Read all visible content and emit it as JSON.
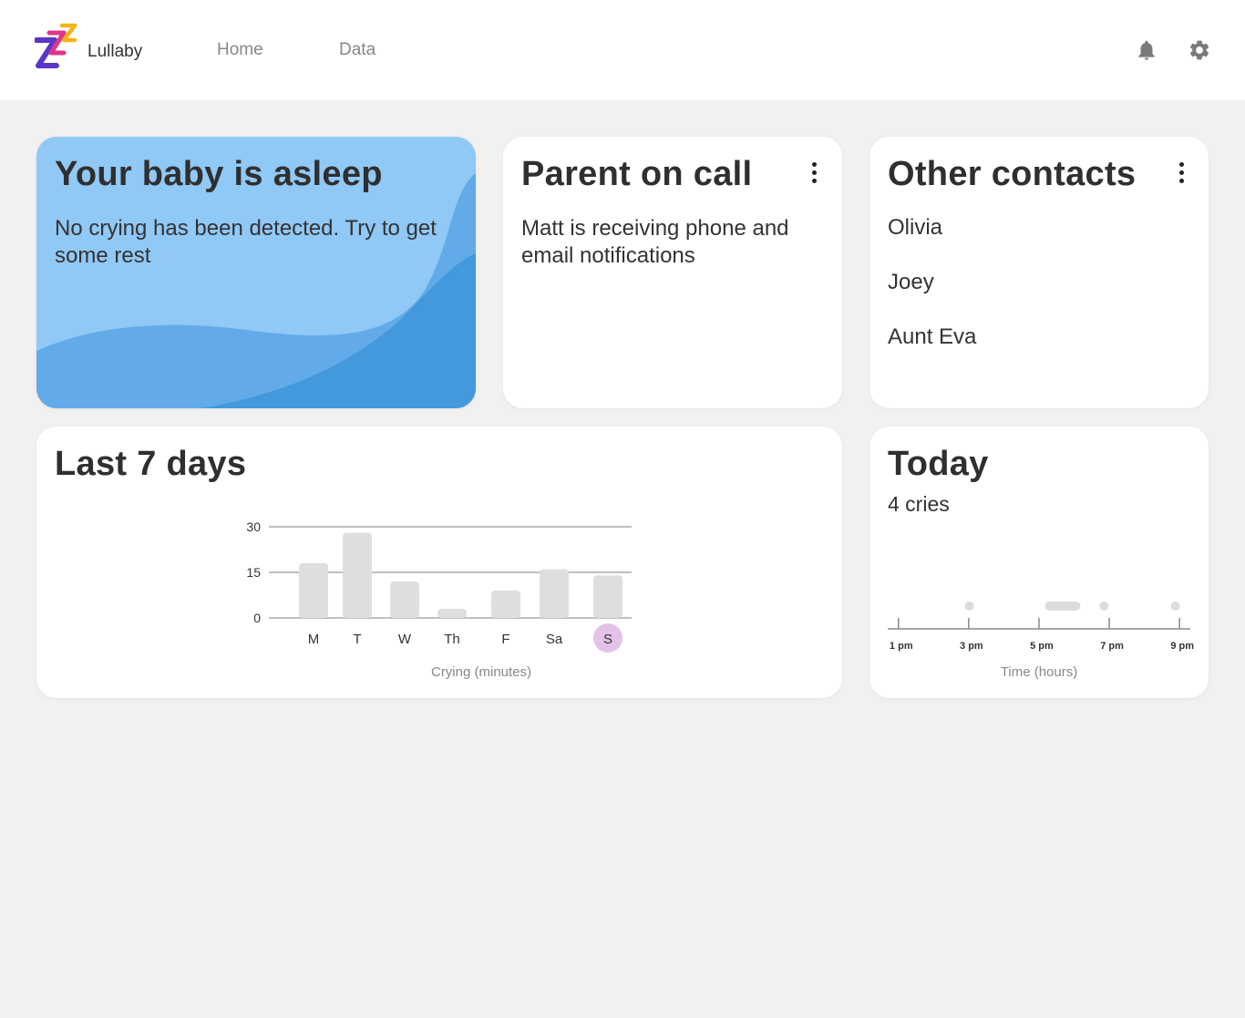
{
  "header": {
    "brand": "Lullaby",
    "nav": {
      "home": "Home",
      "data": "Data"
    },
    "icons": {
      "notifications": "bell-icon",
      "settings": "gear-icon"
    },
    "logo_colors": [
      "#5b35c8",
      "#e0358a",
      "#f6b21a"
    ]
  },
  "status_card": {
    "title": "Your baby is asleep",
    "message": "No crying has been detected. Try to get some rest",
    "colors": {
      "background": "#90c8f6",
      "wave_mid": "#62abe8",
      "wave_dark": "#4399dc"
    }
  },
  "on_call_card": {
    "title": "Parent on call",
    "message": "Matt is receiving phone and email notifications",
    "menu_icon": "more-vertical-icon"
  },
  "contacts_card": {
    "title": "Other contacts",
    "contacts": [
      "Olivia",
      "Joey",
      "Aunt Eva"
    ],
    "menu_icon": "more-vertical-icon"
  },
  "week_card": {
    "title": "Last 7 days",
    "chart_data": {
      "type": "bar",
      "categories": [
        "M",
        "T",
        "W",
        "Th",
        "F",
        "Sa",
        "S"
      ],
      "values": [
        18,
        28,
        12,
        3,
        9,
        16,
        14
      ],
      "ylabel": "",
      "xlabel": "Crying (minutes)",
      "yticks": [
        0,
        15,
        30
      ],
      "ylim": [
        0,
        30
      ],
      "grid": true,
      "highlighted_category": "S",
      "colors": {
        "bar": "#dedede",
        "highlight": "#e3c2ea",
        "grid": "#aaaaaa"
      }
    }
  },
  "today_card": {
    "title": "Today",
    "subtitle": "4 cries",
    "chart_data": {
      "type": "scatter",
      "xlabel": "Time (hours)",
      "x_ticks": [
        "1 pm",
        "3 pm",
        "5 pm",
        "7 pm",
        "9 pm"
      ],
      "x_tick_hours": [
        13,
        15,
        17,
        19,
        21
      ],
      "xlim": [
        12.98,
        20.97
      ],
      "events": [
        {
          "start": 15.02,
          "end": 15.02
        },
        {
          "start": 17.3,
          "end": 18.05
        },
        {
          "start": 18.85,
          "end": 18.85
        },
        {
          "start": 20.88,
          "end": 20.88
        }
      ],
      "colors": {
        "event": "#dcdcdc",
        "axis": "#888888"
      }
    }
  }
}
